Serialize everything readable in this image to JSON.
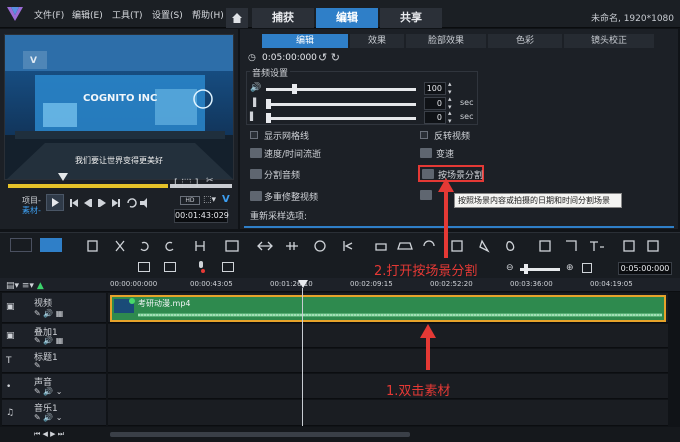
{
  "menubar": {
    "items": [
      "文件(F)",
      "编辑(E)",
      "工具(T)",
      "设置(S)",
      "帮助(H)"
    ],
    "tabs": [
      "捕获",
      "编辑",
      "共享"
    ],
    "status": "未命名, 1920*1080"
  },
  "preview": {
    "banner": "COGNITO INC",
    "subtitle": "我们要让世界变得更美好",
    "project_label": "项目-",
    "clip_label": "素材-",
    "timecode": "00:01:43:029",
    "hd_label": "HD"
  },
  "right_panel": {
    "tabs": [
      "编辑",
      "效果",
      "脸部效果",
      "色彩",
      "镜头校正"
    ],
    "duration": "0:05:00:000",
    "audio_section": "音频设置",
    "volume_value": "100",
    "fade_in_value": "0",
    "fade_out_value": "0",
    "unit": "sec",
    "options_left": [
      "显示网格线",
      "速度/时间流逝",
      "分割音频",
      "多重修整视频"
    ],
    "options_right": [
      "反转视频",
      "变速",
      "按场景分割"
    ],
    "resample_label": "重新采样选项:",
    "tooltip": "按照场景内容或拍摄的日期和时间分割场景"
  },
  "timeline": {
    "timecode": "0:05:00:000",
    "ruler": [
      "00:00:00:000",
      "00:00:43:05",
      "00:01:26:10",
      "00:02:09:15",
      "00:02:52:20",
      "00:03:36:00",
      "00:04:19:05"
    ],
    "tracks": [
      "视频",
      "叠加1",
      "标题1",
      "声音",
      "音乐1"
    ],
    "clip_name": "考研动漫.mp4"
  },
  "annotations": {
    "step2": "2.打开按场景分割",
    "step1": "1.双击素材"
  },
  "colors": {
    "accent": "#2f7fc8",
    "annotation": "#e53935",
    "clip": "#2e8a4e"
  }
}
